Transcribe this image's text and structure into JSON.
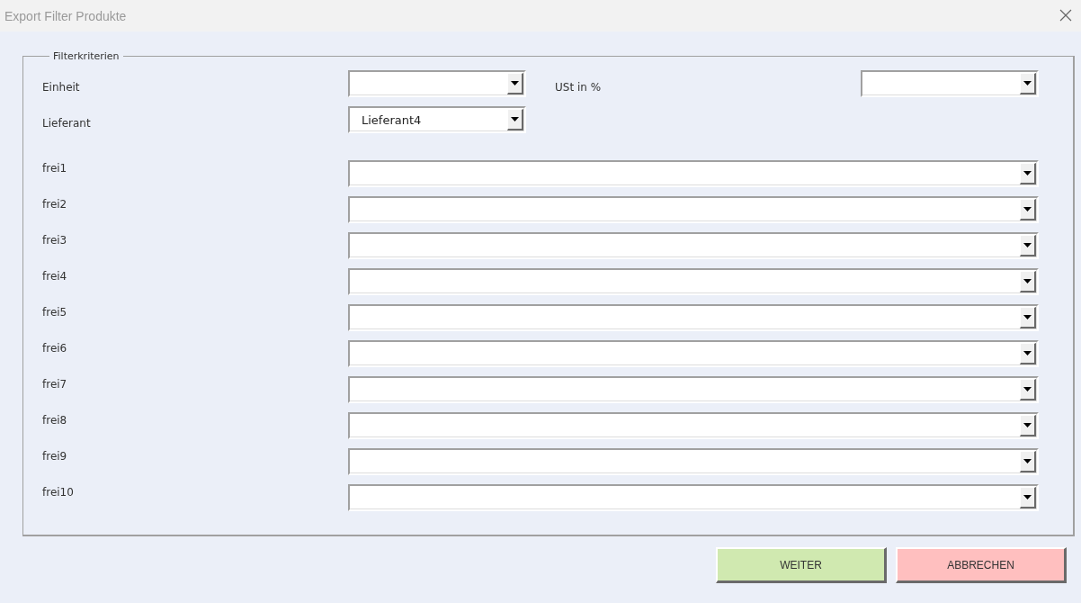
{
  "window": {
    "title": "Export Filter Produkte"
  },
  "group": {
    "title": "Filterkriterien",
    "top_rows": [
      {
        "label": "Einheit",
        "side_label": "USt in %"
      },
      {
        "label": "Lieferant",
        "value": "Lieferant4"
      }
    ],
    "free_rows": [
      {
        "label": "frei1"
      },
      {
        "label": "frei2"
      },
      {
        "label": "frei3"
      },
      {
        "label": "frei4"
      },
      {
        "label": "frei5"
      },
      {
        "label": "frei6"
      },
      {
        "label": "frei7"
      },
      {
        "label": "frei8"
      },
      {
        "label": "frei9"
      },
      {
        "label": "frei10"
      }
    ]
  },
  "buttons": [
    {
      "label": "WEITER",
      "color": "#d0e9b0"
    },
    {
      "label": "ABBRECHEN",
      "color": "#ffbfbf"
    }
  ]
}
